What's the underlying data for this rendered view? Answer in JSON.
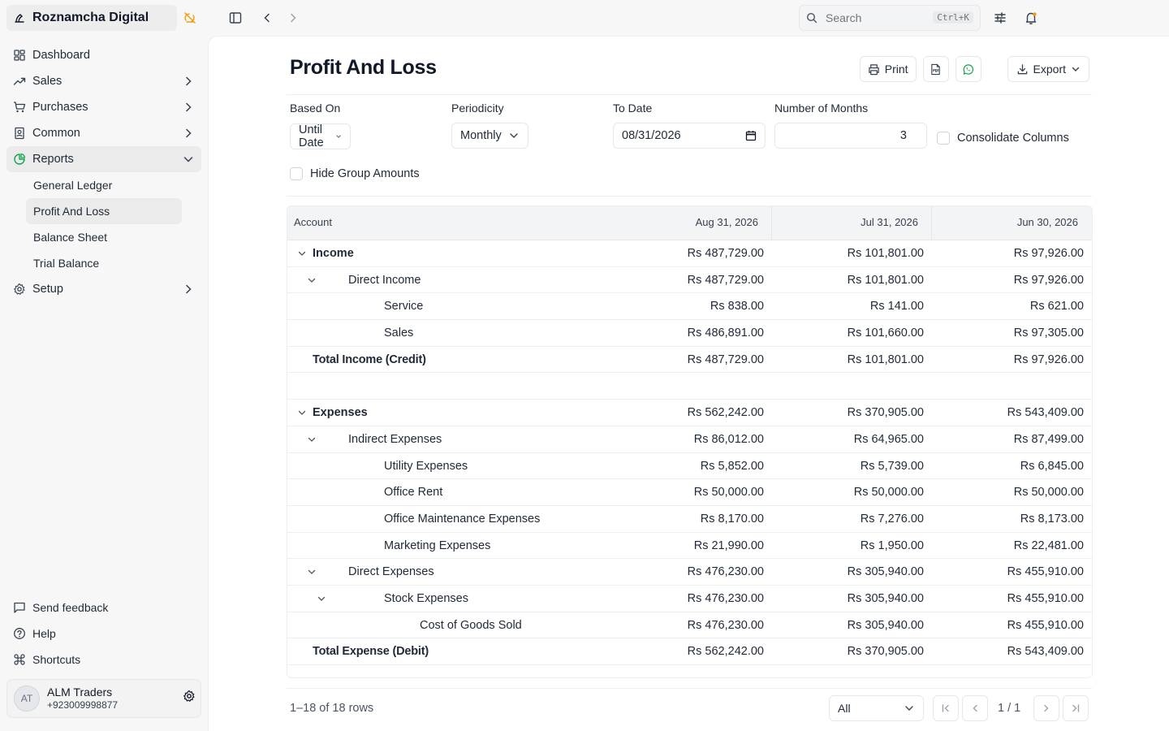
{
  "app": {
    "name": "Roznamcha Digital"
  },
  "sidebar": {
    "items": [
      {
        "label": "Dashboard",
        "icon": "dashboard-icon"
      },
      {
        "label": "Sales",
        "icon": "trending-up-icon"
      },
      {
        "label": "Purchases",
        "icon": "cart-icon"
      },
      {
        "label": "Common",
        "icon": "book-icon"
      },
      {
        "label": "Reports",
        "icon": "pie-chart-icon"
      },
      {
        "label": "Setup",
        "icon": "gear-icon"
      }
    ],
    "reports_sub": [
      "General Ledger",
      "Profit And Loss",
      "Balance Sheet",
      "Trial Balance"
    ],
    "footer": [
      {
        "label": "Send feedback",
        "icon": "message-icon"
      },
      {
        "label": "Help",
        "icon": "help-icon"
      },
      {
        "label": "Shortcuts",
        "icon": "command-icon"
      }
    ],
    "user": {
      "initials": "AT",
      "name": "ALM Traders",
      "phone": "+923009998877"
    }
  },
  "topbar": {
    "search_placeholder": "Search",
    "search_shortcut": "Ctrl+K"
  },
  "page": {
    "title": "Profit And Loss",
    "actions": {
      "print": "Print",
      "export": "Export"
    }
  },
  "filters": {
    "based_on": {
      "label": "Based On",
      "value": "Until Date"
    },
    "periodicity": {
      "label": "Periodicity",
      "value": "Monthly"
    },
    "to_date": {
      "label": "To Date",
      "value": "08/31/2026"
    },
    "months": {
      "label": "Number of Months",
      "value": "3"
    },
    "consolidate": "Consolidate Columns",
    "hide_group": "Hide Group Amounts"
  },
  "table": {
    "columns": [
      "Account",
      "Aug 31, 2026",
      "Jul 31, 2026",
      "Jun 30, 2026"
    ],
    "rows": [
      {
        "account": "Income",
        "level": 0,
        "type": "group",
        "values": [
          "Rs 487,729.00",
          "Rs 101,801.00",
          "Rs 97,926.00"
        ]
      },
      {
        "account": "Direct Income",
        "level": 1,
        "type": "group",
        "values": [
          "Rs 487,729.00",
          "Rs 101,801.00",
          "Rs 97,926.00"
        ]
      },
      {
        "account": "Service",
        "level": 2,
        "type": "leaf",
        "values": [
          "Rs 838.00",
          "Rs 141.00",
          "Rs 621.00"
        ]
      },
      {
        "account": "Sales",
        "level": 2,
        "type": "leaf",
        "values": [
          "Rs 486,891.00",
          "Rs 101,660.00",
          "Rs 97,305.00"
        ]
      },
      {
        "account": "Total Income (Credit)",
        "level": 0,
        "type": "total",
        "values": [
          "Rs 487,729.00",
          "Rs 101,801.00",
          "Rs 97,926.00"
        ]
      },
      {
        "account": "",
        "level": 0,
        "type": "blank",
        "values": [
          "",
          "",
          ""
        ]
      },
      {
        "account": "Expenses",
        "level": 0,
        "type": "group",
        "values": [
          "Rs 562,242.00",
          "Rs 370,905.00",
          "Rs 543,409.00"
        ]
      },
      {
        "account": "Indirect Expenses",
        "level": 1,
        "type": "group",
        "values": [
          "Rs 86,012.00",
          "Rs 64,965.00",
          "Rs 87,499.00"
        ]
      },
      {
        "account": "Utility Expenses",
        "level": 2,
        "type": "leaf",
        "values": [
          "Rs 5,852.00",
          "Rs 5,739.00",
          "Rs 6,845.00"
        ]
      },
      {
        "account": "Office Rent",
        "level": 2,
        "type": "leaf",
        "values": [
          "Rs 50,000.00",
          "Rs 50,000.00",
          "Rs 50,000.00"
        ]
      },
      {
        "account": "Office Maintenance Expenses",
        "level": 2,
        "type": "leaf",
        "values": [
          "Rs 8,170.00",
          "Rs 7,276.00",
          "Rs 8,173.00"
        ]
      },
      {
        "account": "Marketing Expenses",
        "level": 2,
        "type": "leaf",
        "values": [
          "Rs 21,990.00",
          "Rs 1,950.00",
          "Rs 22,481.00"
        ]
      },
      {
        "account": "Direct Expenses",
        "level": 1,
        "type": "group",
        "values": [
          "Rs 476,230.00",
          "Rs 305,940.00",
          "Rs 455,910.00"
        ]
      },
      {
        "account": "Stock Expenses",
        "level": 2,
        "type": "group",
        "values": [
          "Rs 476,230.00",
          "Rs 305,940.00",
          "Rs 455,910.00"
        ]
      },
      {
        "account": "Cost of Goods Sold",
        "level": 3,
        "type": "leaf",
        "values": [
          "Rs 476,230.00",
          "Rs 305,940.00",
          "Rs 455,910.00"
        ]
      },
      {
        "account": "Total Expense (Debit)",
        "level": 0,
        "type": "total",
        "values": [
          "Rs 562,242.00",
          "Rs 370,905.00",
          "Rs 543,409.00"
        ]
      }
    ]
  },
  "pagination": {
    "info": "1–18 of 18 rows",
    "page_size": "All",
    "page": "1 / 1"
  },
  "colors": {
    "accent": "#f59e0b",
    "bg": "#f7f7f7",
    "panel": "#ffffff"
  }
}
